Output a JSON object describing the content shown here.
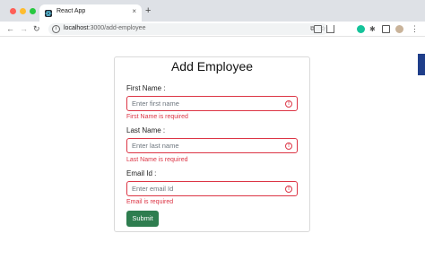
{
  "browser": {
    "tab_title": "React App",
    "tab_close": "×",
    "new_tab": "+",
    "url_host": "localhost",
    "url_path": ":3000/add-employee",
    "nav": {
      "back": "←",
      "forward": "→",
      "reload": "↻"
    },
    "menu": "⋮",
    "extensions": "✱"
  },
  "form": {
    "title": "Add Employee",
    "fields": [
      {
        "label": "First Name :",
        "placeholder": "Enter first name",
        "value": "",
        "error": "First Name is required"
      },
      {
        "label": "Last Name :",
        "placeholder": "Enter last name",
        "value": "",
        "error": "Last Name is required"
      },
      {
        "label": "Email Id :",
        "placeholder": "Enter email Id",
        "value": "",
        "error": "Email is required"
      }
    ],
    "submit_label": "Submit",
    "error_glyph": "!"
  },
  "colors": {
    "error": "#dc3545",
    "submit": "#2e7d4f"
  }
}
